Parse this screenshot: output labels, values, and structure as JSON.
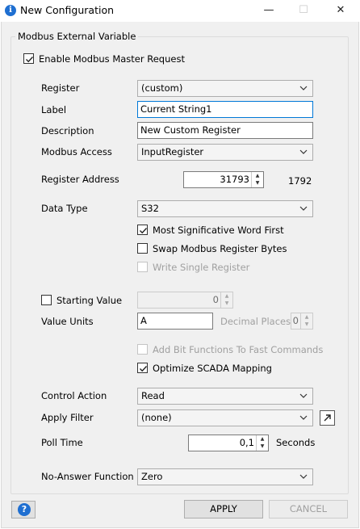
{
  "window": {
    "title": "New Configuration",
    "minimize_glyph": "—",
    "maximize_glyph": "☐",
    "close_glyph": "✕"
  },
  "group": {
    "title": "Modbus External Variable"
  },
  "enable_master_request": {
    "label": "Enable Modbus Master Request",
    "checked": true
  },
  "register": {
    "label": "Register",
    "value": "(custom)"
  },
  "label_field": {
    "label": "Label",
    "value": "Current String1"
  },
  "description": {
    "label": "Description",
    "value": "New Custom Register"
  },
  "modbus_access": {
    "label": "Modbus Access",
    "value": "InputRegister"
  },
  "register_address": {
    "label": "Register Address",
    "value": "31793",
    "offset": "1792"
  },
  "data_type": {
    "label": "Data Type",
    "value": "S32"
  },
  "options": {
    "msw_first": {
      "label": "Most Significative Word First",
      "checked": true,
      "enabled": true
    },
    "swap_bytes": {
      "label": "Swap Modbus Register Bytes",
      "checked": false,
      "enabled": true
    },
    "write_single": {
      "label": "Write Single Register",
      "checked": false,
      "enabled": false
    }
  },
  "starting_value": {
    "label": "Starting Value",
    "checked": false,
    "value": "0"
  },
  "value_units": {
    "label": "Value Units",
    "value": "A"
  },
  "decimal_places": {
    "label": "Decimal Places",
    "value": "0"
  },
  "bit_functions": {
    "label": "Add Bit Functions To Fast Commands",
    "checked": false,
    "enabled": false
  },
  "optimize_scada": {
    "label": "Optimize SCADA Mapping",
    "checked": true,
    "enabled": true
  },
  "control_action": {
    "label": "Control Action",
    "value": "Read"
  },
  "apply_filter": {
    "label": "Apply Filter",
    "value": "(none)"
  },
  "poll_time": {
    "label": "Poll Time",
    "value": "0,1",
    "unit": "Seconds"
  },
  "no_answer": {
    "label": "No-Answer Function",
    "value": "Zero"
  },
  "buttons": {
    "help": "?",
    "apply": "APPLY",
    "cancel": "CANCEL"
  },
  "colors": {
    "accent": "#0078d7",
    "icon_blue": "#1f6fd1",
    "disabled_text": "#a0a0a0"
  }
}
